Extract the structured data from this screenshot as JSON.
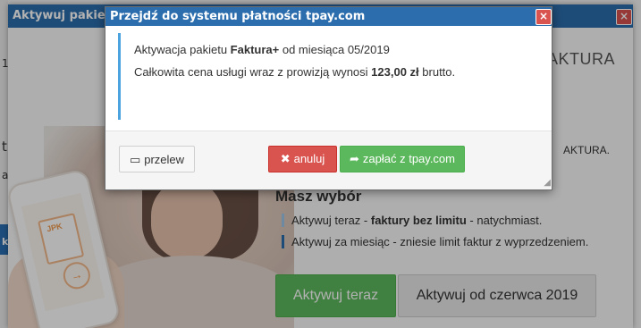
{
  "background_window": {
    "title": "Aktywuj pakiet F",
    "close_label": "×",
    "header_title": "AKTURA",
    "description_end": "AKTURA.",
    "choice_heading": "Masz wybór",
    "bullets": [
      {
        "prefix": "Aktywuj teraz - ",
        "bold": "faktury bez limitu",
        "suffix": " - natychmiast."
      },
      {
        "prefix": "Aktywuj za miesiąc - zniesie limit faktur z wyprzedzeniem.",
        "bold": "",
        "suffix": ""
      }
    ],
    "activate_now_label": "Aktywuj teraz",
    "activate_june_label": "Aktywuj od czerwca 2019",
    "illustration_doc_label": "JPK"
  },
  "modal": {
    "title": "Przejdź do systemu płatności tpay.com",
    "close_label": "×",
    "line1": {
      "prefix": "Aktywacja pakietu ",
      "bold": "Faktura+",
      "suffix": " od miesiąca 05/2019"
    },
    "line2": {
      "prefix": "Całkowita cena usługi wraz z prowizją wynosi ",
      "bold": "123,00 zł",
      "suffix": " brutto."
    },
    "transfer_label": "przelew",
    "cancel_label": "anuluj",
    "pay_label": "zapłać z tpay.com"
  },
  "edge_text": [
    "1",
    "t",
    "a",
    "kt",
    "t",
    "a",
    "t"
  ],
  "colors": {
    "header_blue": "#2c6dad",
    "close_red": "#d9534f",
    "green": "#5cb85c",
    "info_border": "#4aa3df"
  }
}
